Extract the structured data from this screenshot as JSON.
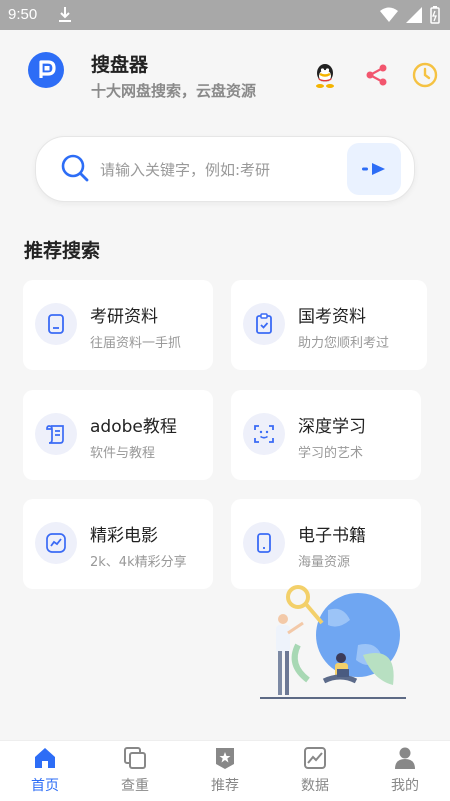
{
  "status_bar": {
    "time": "9:50"
  },
  "header": {
    "title": "搜盘器",
    "subtitle": "十大网盘搜索，云盘资源",
    "icons": [
      "qq-icon",
      "share-icon",
      "clock-icon"
    ]
  },
  "search": {
    "placeholder": "请输入关键字，例如:考研"
  },
  "section": {
    "title": "推荐搜索"
  },
  "cards": [
    {
      "title": "考研资料",
      "subtitle": "往届资料一手抓",
      "icon": "document-icon"
    },
    {
      "title": "国考资料",
      "subtitle": "助力您顺利考过",
      "icon": "clipboard-check-icon"
    },
    {
      "title": "adobe教程",
      "subtitle": "软件与教程",
      "icon": "scroll-icon"
    },
    {
      "title": "深度学习",
      "subtitle": "学习的艺术",
      "icon": "face-scan-icon"
    },
    {
      "title": "精彩电影",
      "subtitle": "2k、4k精彩分享",
      "icon": "chart-line-icon"
    },
    {
      "title": "电子书籍",
      "subtitle": "海量资源",
      "icon": "tablet-icon"
    }
  ],
  "nav": [
    {
      "label": "首页",
      "icon": "home-icon",
      "active": true
    },
    {
      "label": "查重",
      "icon": "copy-icon",
      "active": false
    },
    {
      "label": "推荐",
      "icon": "badge-icon",
      "active": false
    },
    {
      "label": "数据",
      "icon": "chart-icon",
      "active": false
    },
    {
      "label": "我的",
      "icon": "user-icon",
      "active": false
    }
  ],
  "colors": {
    "accent": "#2d6df6",
    "share": "#f2566e",
    "clock": "#f5c242"
  }
}
